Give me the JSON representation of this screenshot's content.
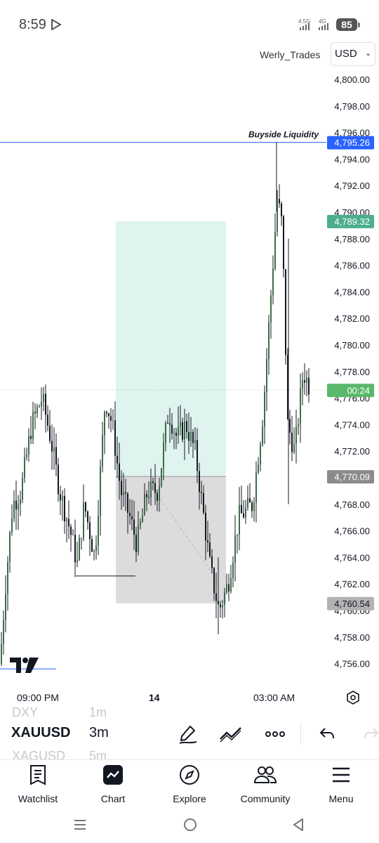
{
  "status_bar": {
    "time": "8:59",
    "net1": "4.5G",
    "net2": "4G",
    "battery": "85"
  },
  "header": {
    "account": "Werly_Trades",
    "currency": "USD"
  },
  "chart_data": {
    "type": "candlestick",
    "symbol": "XAUUSD",
    "timeframe": "3m",
    "y_ticks": [
      "4,800.00",
      "4,798.00",
      "4,796.00",
      "4,794.00",
      "4,792.00",
      "4,790.00",
      "4,788.00",
      "4,786.00",
      "4,784.00",
      "4,782.00",
      "4,780.00",
      "4,778.00",
      "4,776.00",
      "4,774.00",
      "4,772.00",
      "4,770.00",
      "4,768.00",
      "4,766.00",
      "4,764.00",
      "4,762.00",
      "4,760.00",
      "4,758.00",
      "4,756.00"
    ],
    "x_ticks": [
      "09:00 PM",
      "14",
      "03:00 AM"
    ],
    "price_labels": [
      {
        "value": "4,795.26",
        "color": "#2962ff"
      },
      {
        "value": "4,789.32",
        "color": "#4cae8c"
      },
      {
        "value": "00:24",
        "color": "#59b86a"
      },
      {
        "value": "4,770.09",
        "color": "#8a8a8a"
      },
      {
        "value": "4,760.54",
        "color": "#b2b2b2"
      }
    ],
    "annotation": "Buyside Liquidity",
    "position_tool": {
      "entry": 4770.09,
      "target": 4789.32,
      "stop": 4760.54,
      "type": "long"
    },
    "current_price": 4776.6
  },
  "toolbar": {
    "symbol": "XAUUSD",
    "timeframe": "3m",
    "faded_symbol_above": "DXY",
    "faded_symbol_below": "XAGUSD",
    "faded_tf_above": "1m",
    "faded_tf_below": "5m"
  },
  "nav": {
    "items": [
      "Watchlist",
      "Chart",
      "Explore",
      "Community",
      "Menu"
    ]
  }
}
